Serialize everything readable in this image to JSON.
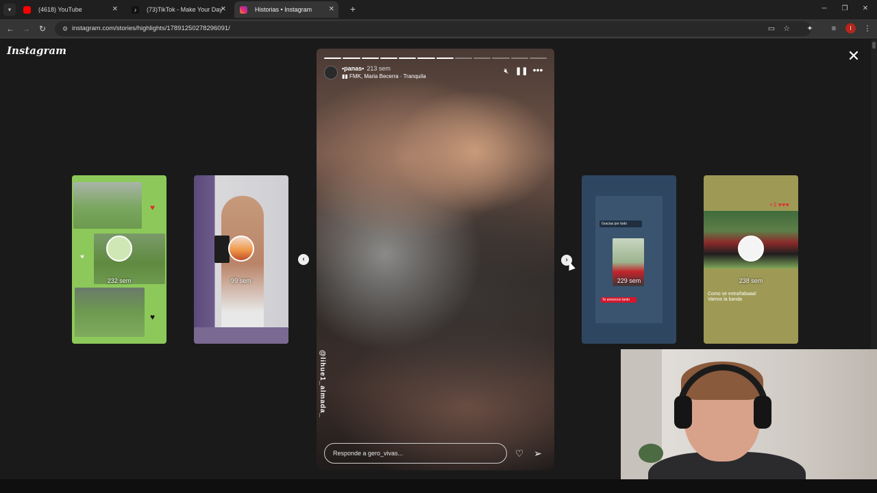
{
  "browser": {
    "tabs": [
      {
        "title": "(4618) YouTube",
        "favicon_color": "#ff0000",
        "active": false
      },
      {
        "title": "(73)TikTok - Make Your Day",
        "favicon_color": "#111111",
        "active": false
      },
      {
        "title": "Historias • Instagram",
        "favicon_color": "#d62976",
        "active": true
      }
    ],
    "url": "instagram.com/stories/highlights/17891250278296091/"
  },
  "page": {
    "logo": "Instagram",
    "previews": [
      {
        "label": "232 sem"
      },
      {
        "label": "99 sem"
      },
      {
        "label": "229 sem",
        "texts": [
          "Gracias por todo",
          "Te amooooo tanto"
        ]
      },
      {
        "label": "238 sem",
        "texts": [
          "Como se extrañabaaa!",
          "Vamos la banda"
        ]
      }
    ]
  },
  "story": {
    "username": "•panas•",
    "time": "213 sem",
    "music": "FMK, Maria Becerra · Tranquila",
    "vertical_text": "@lihue1_almada_",
    "reply_placeholder": "Responde a gero_vivas...",
    "segments_total": 12,
    "segments_done": 7
  },
  "icons": {
    "close": "close-icon",
    "mute": "mute-icon",
    "pause": "pause-icon",
    "more": "more-icon",
    "like": "heart-icon",
    "share": "send-icon"
  }
}
